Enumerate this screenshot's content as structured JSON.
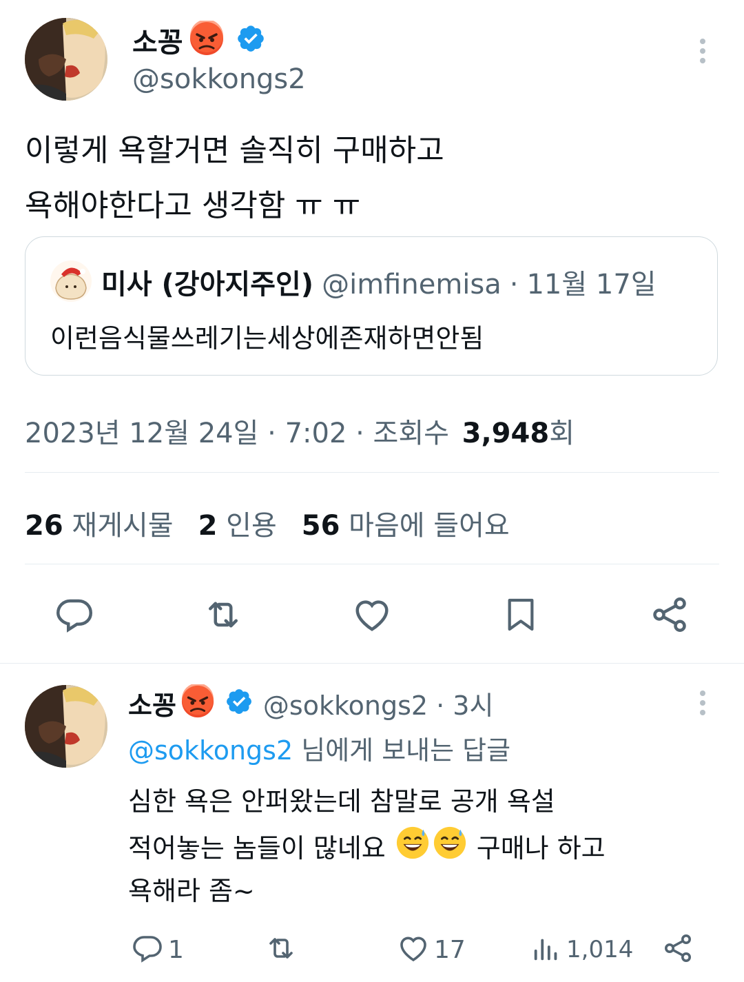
{
  "main_tweet": {
    "author_name": "소꽁",
    "author_emoji": "angry-face",
    "verified": true,
    "handle": "@sokkongs2",
    "text_line1": "이렇게 욕할거면 솔직히 구매하고",
    "text_line2": "욕해야한다고 생각함 ㅠ ㅠ",
    "quoted": {
      "name": "미사 (강아지주인)",
      "handle": "@imfinemisa",
      "sep": "·",
      "date": "11월 17일",
      "text": "이런음식물쓰레기는세상에존재하면안됨"
    },
    "timestamp": "2023년 12월 24일 · 7:02 · 조회수",
    "views_count": "3,948",
    "views_suffix": "회",
    "stats": {
      "retweets_count": "26",
      "retweets_label": "재게시물",
      "quotes_count": "2",
      "quotes_label": "인용",
      "likes_count": "56",
      "likes_label": "마음에 들어요"
    }
  },
  "reply_tweet": {
    "author_name": "소꽁",
    "handle_time": "@sokkongs2 · 3시",
    "replying_to_handle": "@sokkongs2",
    "replying_to_suffix": "님에게 보내는 답글",
    "text_line1": "심한 욕은 안퍼왔는데 참말로 공개 욕설",
    "text_line2_a": "적어놓는 놈들이 많네요",
    "text_line2_b": "구매나 하고",
    "text_line3": "욕해라 좀~",
    "emoji": "grinning-sweat-face",
    "actions": {
      "replies": "1",
      "likes": "17",
      "views": "1,014"
    }
  },
  "colors": {
    "accent": "#1d9bf0",
    "text": "#0f1419",
    "secondary": "#536471",
    "border": "#e6ecf0"
  },
  "icons": [
    "kebab-menu-icon",
    "verified-badge-icon",
    "angry-face-emoji",
    "reply-icon",
    "retweet-icon",
    "like-icon",
    "bookmark-icon",
    "share-icon",
    "views-icon",
    "grinning-sweat-emoji"
  ]
}
